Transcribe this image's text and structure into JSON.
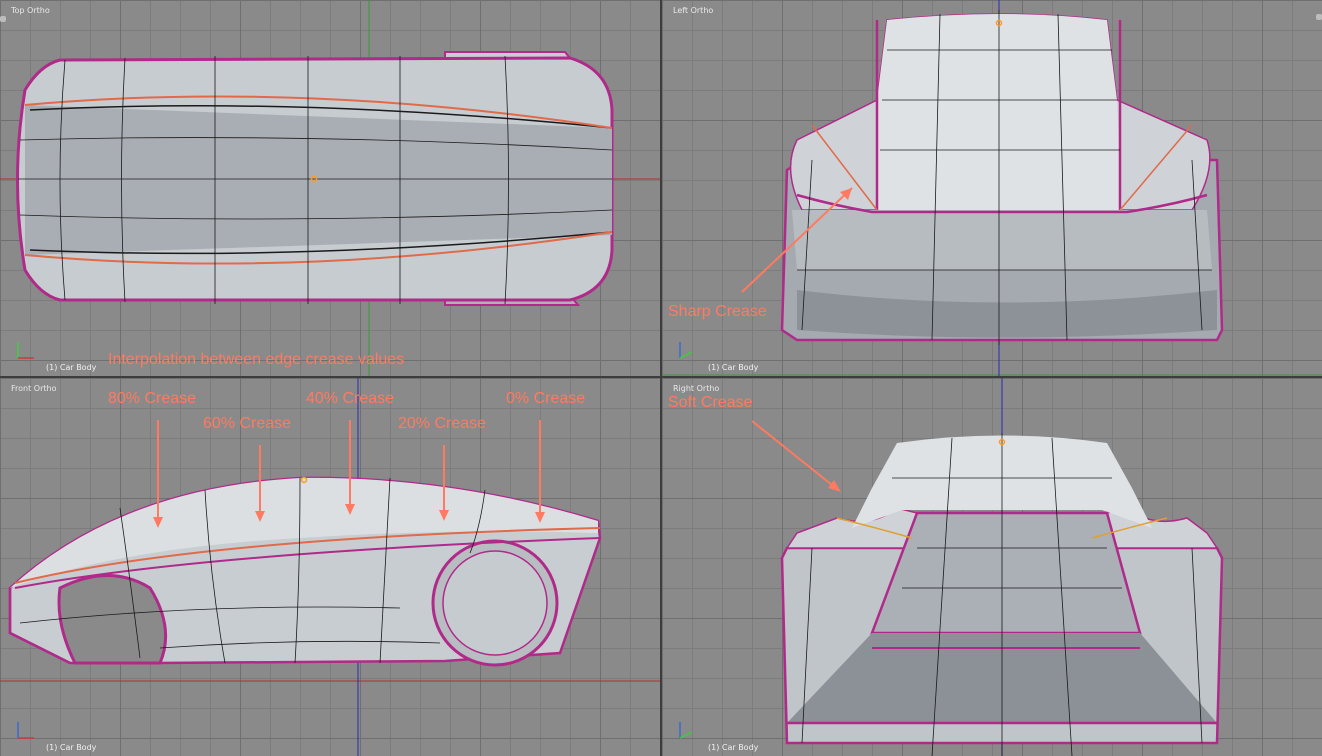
{
  "viewports": {
    "top": {
      "title": "Top Ortho",
      "object": "(1) Car Body"
    },
    "left": {
      "title": "Left Ortho",
      "object": "(1) Car Body"
    },
    "front": {
      "title": "Front Ortho",
      "object": "(1) Car Body"
    },
    "right": {
      "title": "Right Ortho",
      "object": "(1) Car Body"
    }
  },
  "annotations": {
    "interpolation": "Interpolation between edge crease values",
    "sharp": "Sharp Crease",
    "soft": "Soft Crease",
    "c80": "80% Crease",
    "c60": "60% Crease",
    "c40": "40% Crease",
    "c20": "20% Crease",
    "c0": "0% Crease"
  },
  "colors": {
    "annotation": "#ff7a60",
    "crease": "#c0308a",
    "grid": "#8a8a8a"
  }
}
